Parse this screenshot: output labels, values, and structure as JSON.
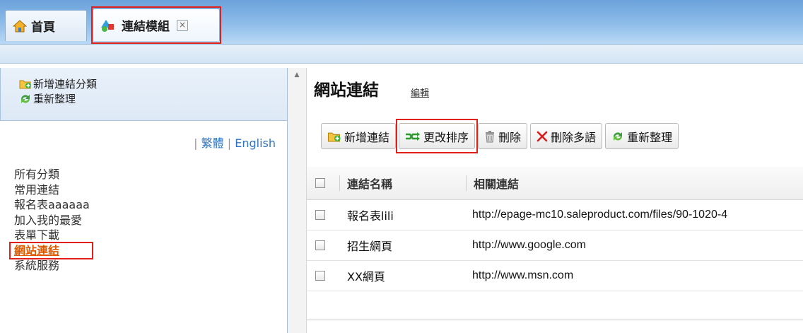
{
  "tabs": [
    {
      "label": "首頁",
      "icon": "home-icon"
    },
    {
      "label": "連結模組",
      "icon": "module-icon",
      "close": "×"
    }
  ],
  "left": {
    "tools": [
      {
        "label": "新增連結分類",
        "icon": "folder-add-icon"
      },
      {
        "label": "重新整理",
        "icon": "refresh-icon"
      }
    ],
    "lang": {
      "sep": "|",
      "traditional": "繁體",
      "english": "English"
    },
    "categories": [
      "所有分類",
      "常用連結",
      "報名表aaaaaa",
      "加入我的最愛",
      "表單下載",
      "網站連結",
      "系統服務"
    ],
    "current_category": "網站連結"
  },
  "main": {
    "title": "網站連結",
    "edit": "編輯",
    "toolbar": [
      {
        "label": "新增連結",
        "icon": "folder-add-icon"
      },
      {
        "label": "更改排序",
        "icon": "sort-icon"
      },
      {
        "label": "刪除",
        "icon": "trash-icon"
      },
      {
        "label": "刪除多語",
        "icon": "delete-x-icon"
      },
      {
        "label": "重新整理",
        "icon": "refresh-icon"
      }
    ],
    "columns": {
      "name": "連結名稱",
      "url": "相關連結"
    },
    "rows": [
      {
        "name": "報名表lili",
        "url": "http://epage-mc10.saleproduct.com/files/90-1020-4"
      },
      {
        "name": "招生網頁",
        "url": "http://www.google.com"
      },
      {
        "name": "XX網頁",
        "url": "http://www.msn.com"
      }
    ]
  },
  "colors": {
    "highlight": "#e0201b",
    "link": "#2f74c0",
    "current": "#e05a00"
  }
}
